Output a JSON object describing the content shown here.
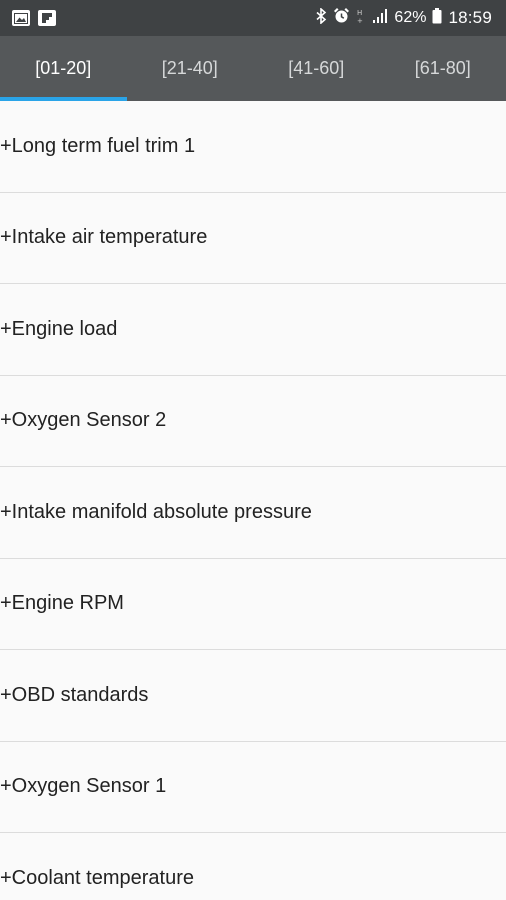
{
  "status_bar": {
    "left_icons": [
      "gallery-icon",
      "flipboard-icon"
    ],
    "right_icons": [
      "bluetooth-icon",
      "alarm-icon",
      "hplus-icon",
      "signal-icon",
      "battery-icon"
    ],
    "battery_percent": "62%",
    "time": "18:59"
  },
  "tabs": [
    {
      "label": "[01-20]",
      "active": true
    },
    {
      "label": "[21-40]",
      "active": false
    },
    {
      "label": "[41-60]",
      "active": false
    },
    {
      "label": "[61-80]",
      "active": false
    }
  ],
  "list": {
    "items": [
      "+Long term fuel trim 1",
      "+Intake air temperature",
      "+Engine load",
      "+Oxygen Sensor 2",
      "+Intake manifold absolute pressure",
      "+Engine RPM",
      "+OBD standards",
      "+Oxygen Sensor 1",
      "+Coolant temperature"
    ]
  },
  "colors": {
    "status_bar_bg": "#3f4244",
    "tab_bar_bg": "#55585a",
    "tab_indicator": "#2aa4e8",
    "list_bg": "#fafafa"
  }
}
